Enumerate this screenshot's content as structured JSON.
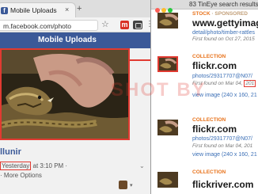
{
  "browser": {
    "tab_title": "Mobile Uploads",
    "tab_close": "×",
    "new_tab": "+",
    "url": "m.facebook.com/photo",
    "star_glyph": "☆",
    "ext_m_label": "m",
    "menu_glyph": "⋮"
  },
  "facebook": {
    "brand_color": "#3b5998",
    "page_title": "Mobile Uploads",
    "post": {
      "author": "llunir",
      "time_prefix": "",
      "time_day": "Yesterday",
      "time_rest": " at 3:10 PM · ",
      "more_options": "· More Options",
      "chevron": "⌄"
    }
  },
  "tineye": {
    "window_title": "83 TinEye search results",
    "accent_color": "#e8731c",
    "results": [
      {
        "kind": "STOCK",
        "kind_extra": "· SPONSORED",
        "site": "www.gettyimages.com",
        "link": "detail/photo/timber-rattles",
        "found_prefix": "First found on Oct 27, 2015",
        "found_highlight": "",
        "found_rest": ""
      },
      {
        "kind": "COLLECTION",
        "kind_extra": "",
        "site": "flickr.com",
        "link": "photos/29317707@N07/",
        "found_prefix": "First found on Mar 04, ",
        "found_highlight": "201",
        "found_rest": "",
        "view_image": "view image (240 x 160, 21"
      },
      {
        "kind": "COLLECTION",
        "kind_extra": "",
        "site": "flickr.com",
        "link": "photos/29317707@N07/",
        "found_prefix": "First found on Mar 04, 201",
        "found_highlight": "",
        "found_rest": "",
        "view_image": "view image (240 x 160, 21"
      },
      {
        "kind": "COLLECTION",
        "kind_extra": "",
        "site": "flickriver.com"
      }
    ]
  },
  "watermark": "SHOT BY"
}
